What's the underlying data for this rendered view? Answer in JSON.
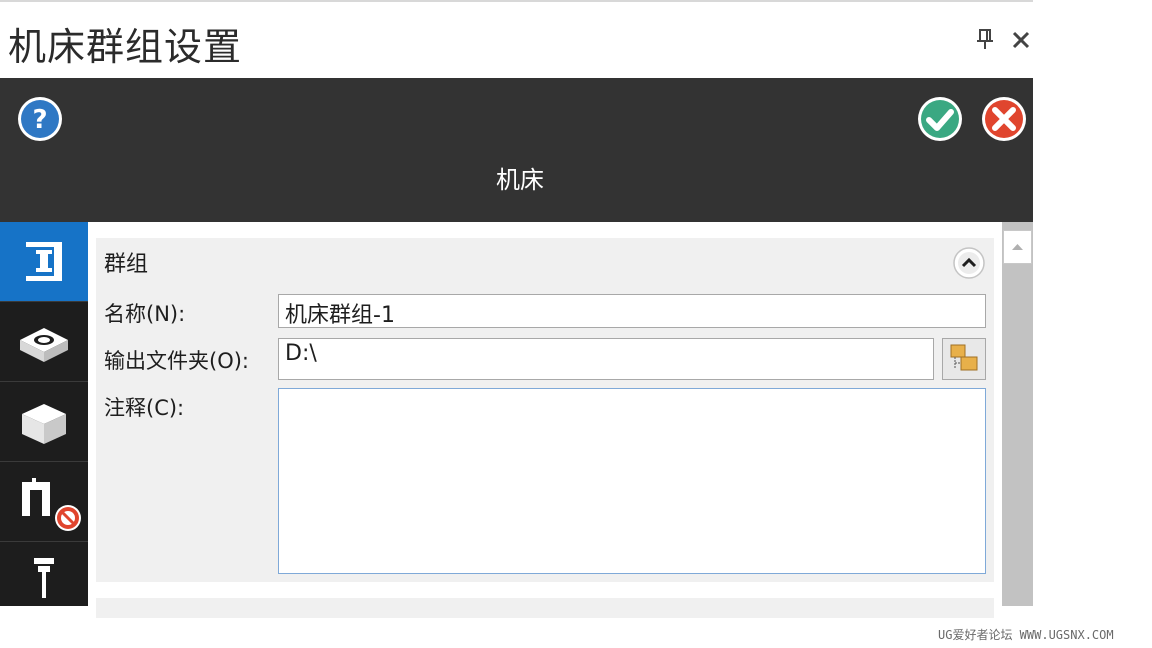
{
  "window": {
    "title": "机床群组设置"
  },
  "header": {
    "label": "机床"
  },
  "sidebar": {
    "items": [
      {
        "icon": "machine-column-icon",
        "active": true
      },
      {
        "icon": "stock-setup-icon",
        "active": false
      },
      {
        "icon": "solid-block-icon",
        "active": false
      },
      {
        "icon": "fixture-disabled-icon",
        "active": false
      },
      {
        "icon": "tool-holder-icon",
        "active": false
      }
    ]
  },
  "group": {
    "title": "群组",
    "name_label": "名称(N):",
    "name_value": "机床群组-1",
    "output_label": "输出文件夹(O):",
    "output_value": "D:\\",
    "comment_label": "注释(C):",
    "comment_value": ""
  },
  "watermark": "UG爱好者论坛 WWW.UGSNX.COM",
  "colors": {
    "header_bg": "#333333",
    "sidebar_bg": "#1d1d1d",
    "active_blue": "#1673c7",
    "ok_green": "#3aa882",
    "cancel_red": "#e0452e",
    "help_blue": "#2f78c4"
  }
}
